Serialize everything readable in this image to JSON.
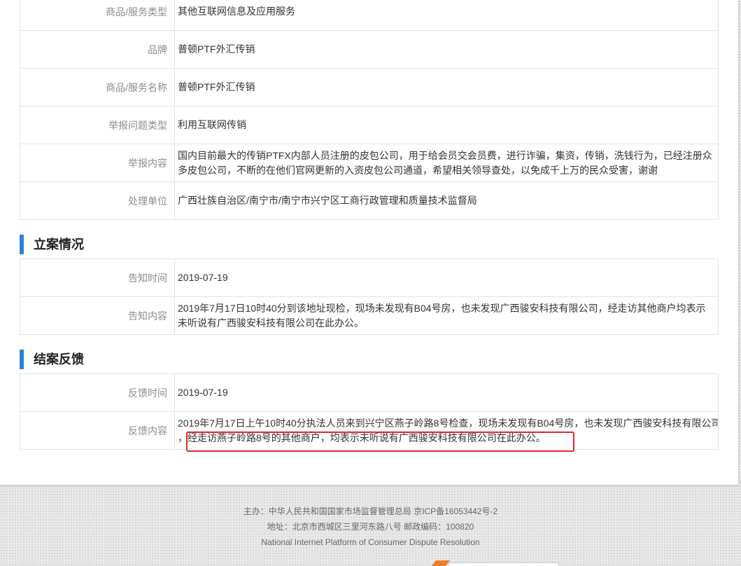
{
  "complaint": {
    "rows": [
      {
        "label": "商品/服务类型",
        "value": "其他互联网信息及应用服务"
      },
      {
        "label": "品牌",
        "value": "普顿PTF外汇传销"
      },
      {
        "label": "商品/服务名称",
        "value": "普顿PTF外汇传销"
      },
      {
        "label": "举报问题类型",
        "value": "利用互联网传销"
      },
      {
        "label": "举报内容",
        "lines": [
          "国内目前最大的传销PTFX内部人员注册的皮包公司，用于给会员交会员费，进行诈骗，集资，传销，洗钱行为，已经注册众",
          "多皮包公司，不断的在他们官网更新的入资皮包公司通道，希望相关领导查处，以免成千上万的民众受害，谢谢"
        ]
      },
      {
        "label": "处理单位",
        "value": "广西壮族自治区/南宁市/南宁市兴宁区工商行政管理和质量技术监督局"
      }
    ]
  },
  "filing": {
    "title": "立案情况",
    "rows": [
      {
        "label": "告知时间",
        "value": "2019-07-19"
      },
      {
        "label": "告知内容",
        "lines": [
          "2019年7月17日10时40分到该地址现检，现场未发现有B04号房，也未发现广西骏安科技有限公司，经走访其他商户均表示",
          "未听说有广西骏安科技有限公司在此办公。"
        ]
      }
    ]
  },
  "closing": {
    "title": "结案反馈",
    "rows": [
      {
        "label": "反馈时间",
        "value": "2019-07-19"
      },
      {
        "label": "反馈内容",
        "lines": [
          "2019年7月17日上午10时40分执法人员来到兴宁区燕子岭路8号检查，现场未发现有B04号房，也未发现广西骏安科技有限公司",
          "，经走访燕子岭路8号的其他商户，均表示未听说有广西骏安科技有限公司在此办公。"
        ]
      }
    ]
  },
  "footer": {
    "sponsor": "主办：中华人民共和国国家市场监督管理总局 京ICP备16053442号-2",
    "address": "地址：北京市西城区三里河东路八号 邮政编码：100820",
    "english_name": "National Internet Platform of Consumer Dispute Resolution"
  },
  "colors": {
    "accent": "#2a82d9",
    "highlight": "#e3262b",
    "border": "#e4e4e4",
    "label": "#8c8c8c",
    "text": "#333333",
    "footer-text": "#666666"
  }
}
